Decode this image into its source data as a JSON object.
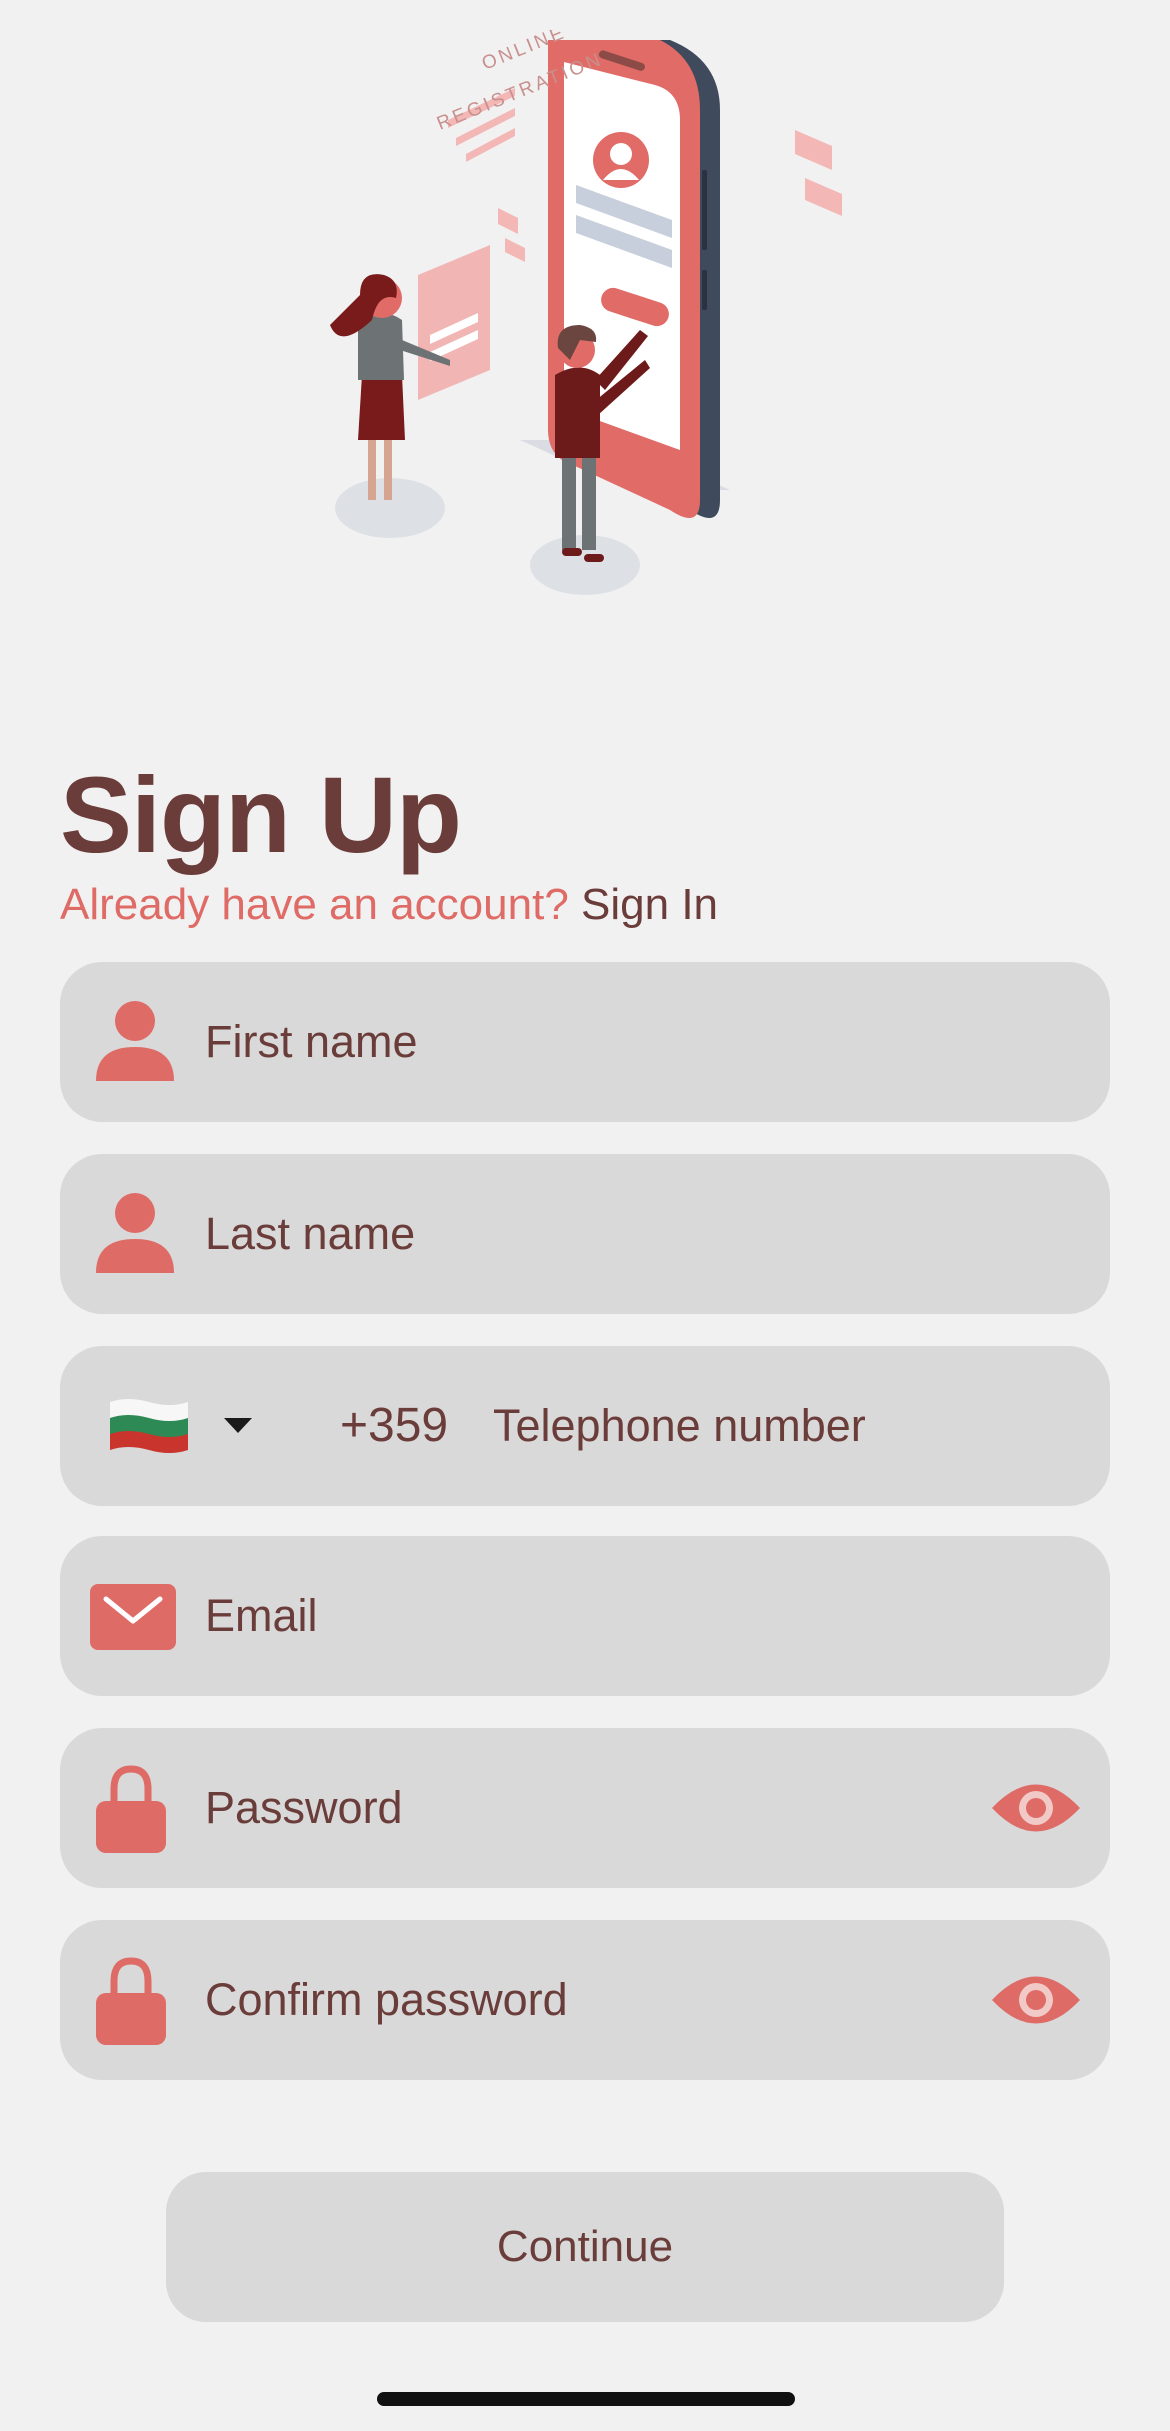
{
  "illustration": {
    "banner_text_line1": "ONLINE",
    "banner_text_line2": "REGISTRATION"
  },
  "header": {
    "title": "Sign Up",
    "signin_prompt": "Already have an account?",
    "signin_link": "Sign In"
  },
  "form": {
    "first_name_placeholder": "First name",
    "last_name_placeholder": "Last name",
    "country_code": "+359",
    "telephone_placeholder": "Telephone number",
    "email_placeholder": "Email",
    "password_placeholder": "Password",
    "confirm_password_placeholder": "Confirm password"
  },
  "icons": {
    "person": "person-icon",
    "mail": "mail-icon",
    "lock": "lock-icon",
    "eye": "eye-icon",
    "flag": "bulgaria-flag-icon",
    "caret": "chevron-down-icon"
  },
  "continue_label": "Continue",
  "colors": {
    "accent": "#df6b66",
    "text_dark": "#6b3d3a",
    "field_bg": "#d9d9d9",
    "page_bg": "#f2f1f1"
  }
}
